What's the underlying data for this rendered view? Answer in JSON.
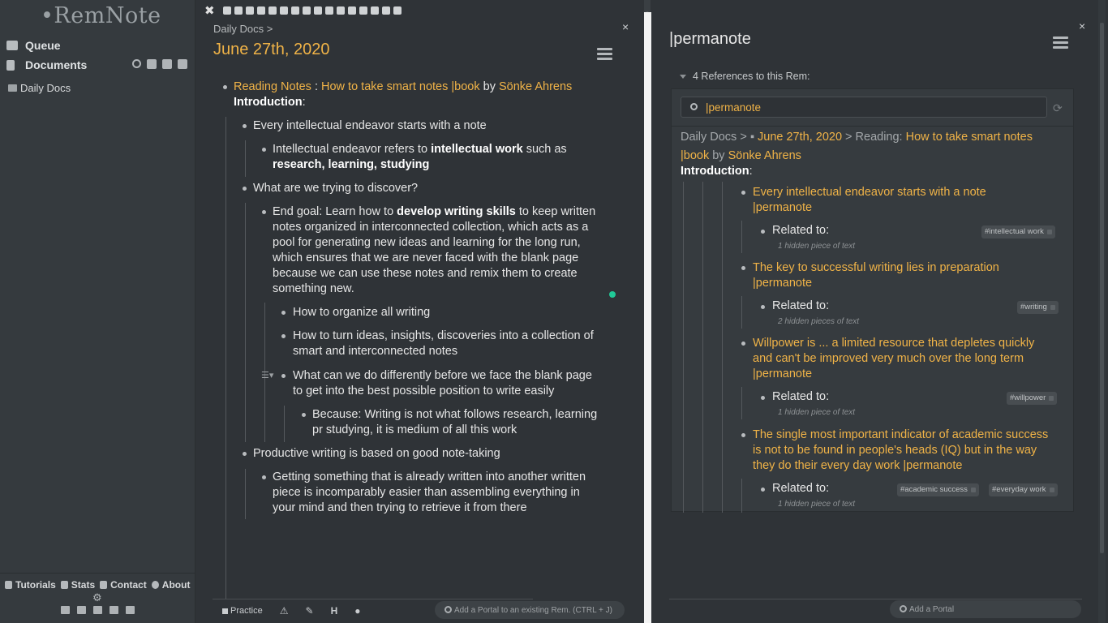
{
  "app": {
    "logo": "•RemNote"
  },
  "sidebar": {
    "queue": "Queue",
    "documents": "Documents",
    "folder": "Daily Docs",
    "footer": {
      "tutorials": "Tutorials",
      "stats": "Stats",
      "contact": "Contact",
      "about": "About",
      "gear": "⚙"
    }
  },
  "editor": {
    "close": "×",
    "tab_close": "✖",
    "tab_count": 16,
    "breadcrumb": "Daily Docs  >",
    "title": "June 27th, 2020",
    "top": {
      "reading_notes": "Reading Notes",
      "colon": " : ",
      "book": "How to take smart notes |book",
      "by": " by ",
      "author": "Sönke Ahrens",
      "intro": "Introduction",
      "intro_colon": ":"
    },
    "items": {
      "i1": "Every intellectual endeavor starts with a note",
      "i1a_pre": "Intellectual endeavor refers to ",
      "i1a_bold": "intellectual work",
      "i1a_post": " such as",
      "i1a_line2": "research, learning, studying",
      "i2": "What are we trying to discover?",
      "i2a_pre": "End goal: Learn how to ",
      "i2a_bold": "develop writing skills",
      "i2a_post": " to keep written",
      "i2a_l2": "notes organized in interconnected collection, which acts as a",
      "i2a_l3": "pool for generating new ideas and learning for the long run,",
      "i2a_l4": "which ensures that we are never faced with the blank page",
      "i2a_l5": "because we can use these notes and remix them to create",
      "i2a_l6": "something new.",
      "i2b": "How to organize all writing",
      "i2c_l1": "How to turn ideas, insights, discoveries into a collection of",
      "i2c_l2": "smart and interconnected notes",
      "i2d_l1": "What can we do differently before we face the blank page",
      "i2d_l2": "to get into the best possible position to write easily",
      "i2e_pre": "Because: ",
      "i2e_bold": "Writing is not what follows research, learning",
      "i2e_l2": "pr studying, it is medium of all this work",
      "i3": "Productive writing is based on good note-taking",
      "i3a_l1": "Getting something that is already written into another written",
      "i3a_l2": "piece is incomparably easier than assembling everything in",
      "i3a_l3": "your mind and then trying to retrieve it from there"
    },
    "handle": "☰▾",
    "toolbar": {
      "practice": "Practice",
      "warn": "⚠",
      "brush": "✎",
      "heading": "H",
      "circle": "●"
    },
    "portal_placeholder": "Add a Portal to an existing Rem. (CTRL + J)"
  },
  "right": {
    "title": "|permanote",
    "close": "×",
    "refs_count": "4 References to this Rem:",
    "search_value": "|permanote",
    "refresh": "⟳",
    "crumb": {
      "daily": "Daily Docs",
      "sep1": " > ",
      "date": "June 27th, 2020",
      "sep2": " > ",
      "reading": "Reading: ",
      "book1": "How to take smart notes",
      "book2": "|book",
      "by": " by ",
      "author": "Sönke Ahrens",
      "intro": "Introduction",
      "colon": ":"
    },
    "refs": [
      {
        "l1": "Every intellectual endeavor starts with a note",
        "l2": "|permanote",
        "related": "Related to:",
        "hidden": "1 hidden piece of text",
        "tags": [
          "#intellectual work"
        ]
      },
      {
        "l1": "The key to successful writing lies in preparation",
        "l2": "|permanote",
        "related": "Related to:",
        "hidden": "2 hidden pieces of text",
        "tags": [
          "#writing"
        ]
      },
      {
        "l1": "Willpower is ... a limited resource that depletes quickly",
        "l2": "and can't be improved very much over the long term",
        "l3": "|permanote",
        "related": "Related to:",
        "hidden": "1 hidden piece of text",
        "tags": [
          "#willpower"
        ]
      },
      {
        "l1": "The single most important indicator of academic success",
        "l2": "is not to be found in people's heads (IQ) but in the way",
        "l3": "they do their every day work  |permanote",
        "related": "Related to:",
        "hidden": "1 hidden piece of text",
        "tags": [
          "#academic success",
          "#everyday work"
        ]
      }
    ],
    "portal_placeholder": "Add a Portal"
  },
  "colors": {
    "accent": "#f0b347",
    "background": "#2f3337",
    "sidebar": "#353a3e",
    "highlight_dot": "#20c997"
  },
  "icons": [
    "search-icon",
    "add-folder-icon",
    "calendar-icon",
    "document-icon",
    "queue-icon",
    "folder-icon",
    "gear-icon",
    "hamburger-menu-icon",
    "close-icon",
    "refresh-icon"
  ]
}
